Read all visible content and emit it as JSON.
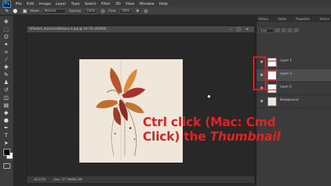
{
  "app": {
    "logo": "Ps"
  },
  "menu": [
    "File",
    "Edit",
    "Image",
    "Layer",
    "Type",
    "Select",
    "Filter",
    "3D",
    "View",
    "Window",
    "Help"
  ],
  "options": {
    "mode_label": "Mode:",
    "mode_value": "Normal",
    "opacity_label": "Opacity:",
    "opacity_value": "100%",
    "flow_label": "Flow:",
    "flow_value": "100%"
  },
  "document": {
    "tab_title": "KPasbet_AutumnsBaktory-4.jpg @ 16.7% (RGB/8)",
    "zoom": "16.67%",
    "doc_size": "Doc: 57.1M/80.5M"
  },
  "panels": {
    "tabs": [
      "History",
      "Styles",
      "Properties",
      "Actions"
    ],
    "filter_value": "Kind",
    "layers": [
      {
        "name": "Layer 1",
        "selected": false
      },
      {
        "name": "Layer 3",
        "selected": true
      },
      {
        "name": "Layer 2",
        "selected": false
      },
      {
        "name": "Background",
        "selected": false
      }
    ]
  },
  "caption": {
    "line1": "Ctrl click (Mac: Cmd",
    "line2_prefix": "Click) the ",
    "line2_italic": "Thumbnail"
  },
  "colors": {
    "caption": "#e32222",
    "highlight": "#e02020",
    "foreground": "#000000",
    "background": "#ffffff"
  }
}
